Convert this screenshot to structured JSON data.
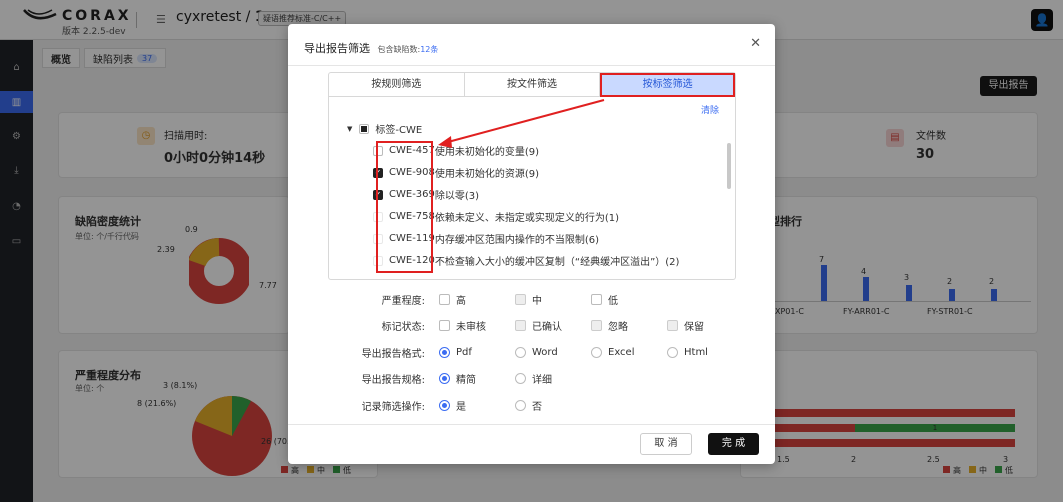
{
  "app": {
    "brand": "CORAX",
    "version": "版本 2.2.5-dev",
    "project": "cyxretest",
    "project_sep": "/",
    "project_num": "1",
    "rule_tag": "疑语推荐标准-C/C++"
  },
  "page_tabs": [
    {
      "label": "概览"
    },
    {
      "label": "缺陷列表",
      "count": "37"
    }
  ],
  "export_button": "导出报告",
  "background": {
    "scan_time_label": "扫描用时:",
    "scan_time_value": "0小时0分钟14秒",
    "file_count_label": "文件数",
    "file_count_value": "30",
    "density_title": "缺陷密度统计",
    "density_unit": "单位: 个/千行代码",
    "density_labels": [
      "0.9",
      "2.39",
      "7.77"
    ],
    "severity_title": "严重程度分布",
    "severity_unit": "单位: 个",
    "severity_labels": [
      "3 (8.1%)",
      "8 (21.6%)",
      "26 (70."
    ],
    "legend": [
      "高",
      "中",
      "低"
    ],
    "ranking_title": "型排行",
    "bar_values": [
      "7",
      "4",
      "3",
      "2",
      "2"
    ],
    "bar_axis": [
      "XP01-C",
      "FY-ARR01-C",
      "FY-STR01-C"
    ],
    "hbar_axis": [
      "1.5",
      "2",
      "2.5",
      "3"
    ],
    "hbar_value": "1"
  },
  "modal": {
    "title": "导出报告筛选",
    "subtitle_prefix": "包含缺陷数:",
    "subtitle_count": "12条",
    "filter_tabs": [
      "按规则筛选",
      "按文件筛选",
      "按标签筛选"
    ],
    "selected_tab": 2,
    "clear_label": "清除",
    "tree_root": "标签-CWE",
    "tree_items": [
      {
        "code": "CWE-457",
        "desc": "使用未初始化的变量(9)",
        "checked": false
      },
      {
        "code": "CWE-908",
        "desc": "使用未初始化的资源(9)",
        "checked": true
      },
      {
        "code": "CWE-369",
        "desc": "除以零(3)",
        "checked": true
      },
      {
        "code": "CWE-758",
        "desc": "依赖未定义、未指定或实现定义的行为(1)",
        "checked": false
      },
      {
        "code": "CWE-119",
        "desc": "内存缓冲区范围内操作的不当限制(6)",
        "checked": false
      },
      {
        "code": "CWE-120",
        "desc": "不检查输入大小的缓冲区复制（“经典缓冲区溢出”）(2)",
        "checked": false
      }
    ],
    "severity": {
      "label": "严重程度:",
      "options": [
        "高",
        "中",
        "低"
      ]
    },
    "mark_status": {
      "label": "标记状态:",
      "options": [
        "未审核",
        "已确认",
        "忽略",
        "保留"
      ]
    },
    "format": {
      "label": "导出报告格式:",
      "options": [
        "Pdf",
        "Word",
        "Excel",
        "Html"
      ],
      "selected": "Pdf"
    },
    "spec": {
      "label": "导出报告规格:",
      "options": [
        "精简",
        "详细"
      ],
      "selected": "精简"
    },
    "record": {
      "label": "记录筛选操作:",
      "options": [
        "是",
        "否"
      ],
      "selected": "是"
    },
    "cancel": "取 消",
    "confirm": "完 成"
  },
  "colors": {
    "accent": "#3b6cf2",
    "high": "#d9443e",
    "medium": "#e7b02a",
    "low": "#3aa64a",
    "annotation": "#e02020"
  }
}
